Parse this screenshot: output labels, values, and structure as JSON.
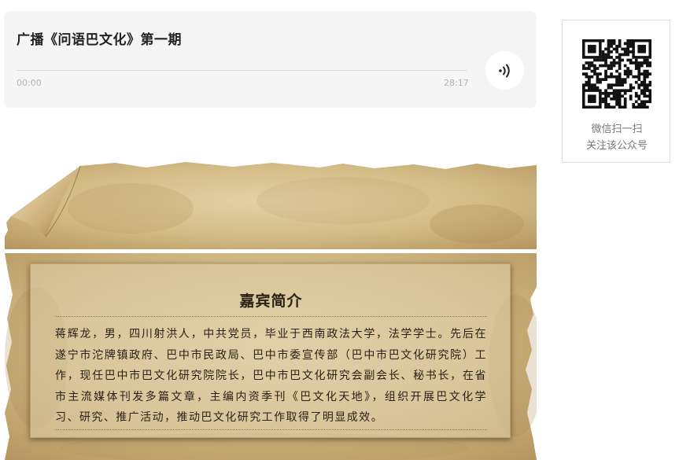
{
  "audio": {
    "title": "广播《问语巴文化》第一期",
    "time_start": "00:00",
    "time_end": "28:17",
    "progress": 0
  },
  "qr": {
    "caption_line1": "微信扫一扫",
    "caption_line2": "关注该公众号"
  },
  "intro": {
    "title": "嘉宾简介",
    "body": "蒋辉龙，男，四川射洪人，中共党员，毕业于西南政法大学，法学学士。先后在遂宁市沱牌镇政府、巴中市民政局、巴中市委宣传部（巴中市巴文化研究院）工作，现任巴中市巴文化研究院院长，巴中市巴文化研究会副会长、秘书长，在省市主流媒体刊发多篇文章，主编内资季刊《巴文化天地》，组织开展巴文化学习、研究、推广活动，推动巴文化研究工作取得了明显成效。"
  },
  "icons": {
    "play": "audio-wave-icon",
    "qr": "qr-code-icon"
  },
  "colors": {
    "card_bg": "#f5f5f5",
    "parchment": "#d8c397",
    "text_dark": "#2b2016"
  }
}
